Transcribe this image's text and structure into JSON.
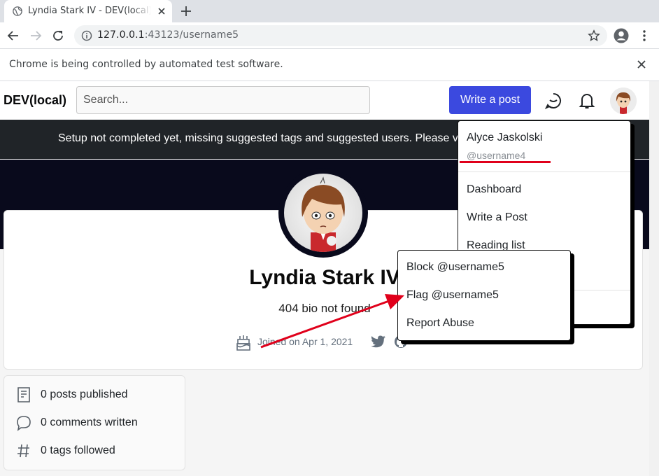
{
  "browser": {
    "tab_title": "Lyndia Stark IV - DEV(local)",
    "url_host": "127.0.0.1",
    "url_rest": ":43123/username5",
    "infobar_message": "Chrome is being controlled by automated test software."
  },
  "header": {
    "logo": "DEV(local)",
    "search_placeholder": "Search...",
    "write_post_label": "Write a post"
  },
  "banner": {
    "text": "Setup not completed yet, missing suggested tags and suggested users. Please v"
  },
  "profile": {
    "name": "Lyndia Stark IV",
    "bio": "404 bio not found",
    "joined": "Joined on Apr 1, 2021"
  },
  "stats": [
    {
      "icon": "post-icon",
      "label": "0 posts published"
    },
    {
      "icon": "comment-icon",
      "label": "0 comments written"
    },
    {
      "icon": "hashtag-icon",
      "label": "0 tags followed"
    }
  ],
  "user_menu": {
    "name": "Alyce Jaskolski",
    "handle": "@username4",
    "items": [
      "Dashboard",
      "Write a Post",
      "Reading list"
    ]
  },
  "profile_actions": {
    "items": [
      "Block @username5",
      "Flag @username5",
      "Report Abuse"
    ]
  },
  "annotation_colors": {
    "accent": "#3b49df",
    "arrow": "#e0001b"
  }
}
